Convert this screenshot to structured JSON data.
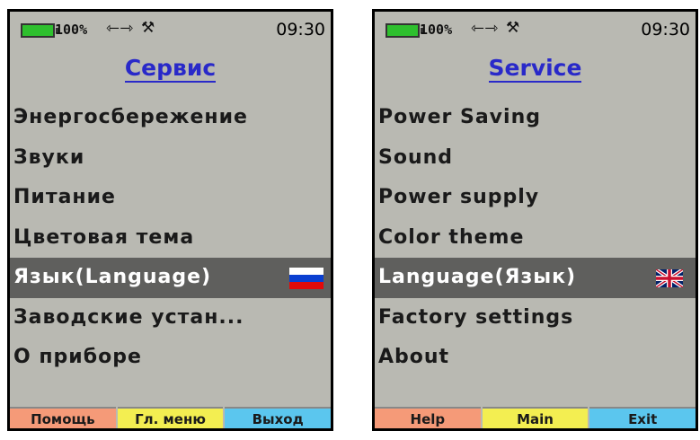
{
  "status": {
    "battery_percent": "100%",
    "usb_icon": "usb-icon",
    "tool_icon": "tool-icon",
    "time": "09:30"
  },
  "screens": [
    {
      "language": "ru",
      "title": "Сервис",
      "items": [
        {
          "label": "Энергосбережение"
        },
        {
          "label": "Звуки"
        },
        {
          "label": "Питание"
        },
        {
          "label": "Цветовая тема"
        },
        {
          "label": "Язык(Language)",
          "selected": true,
          "flag": "russia-flag-icon"
        },
        {
          "label": "Заводские устан..."
        },
        {
          "label": "О приборе"
        }
      ],
      "softkeys": {
        "help": "Помощь",
        "main": "Гл. меню",
        "exit": "Выход"
      }
    },
    {
      "language": "en",
      "title": "Service",
      "items": [
        {
          "label": "Power Saving"
        },
        {
          "label": "Sound"
        },
        {
          "label": "Power supply"
        },
        {
          "label": "Color theme"
        },
        {
          "label": "Language(Язык)",
          "selected": true,
          "flag": "uk-flag-icon"
        },
        {
          "label": "Factory settings"
        },
        {
          "label": "About"
        }
      ],
      "softkeys": {
        "help": "Help",
        "main": "Main",
        "exit": "Exit"
      }
    }
  ],
  "colors": {
    "screen_bg": "#b9b9b2",
    "title": "#2929c9",
    "selected_bg": "#5f5f5d",
    "battery": "#2ec02e",
    "softkey_help": "#f59a78",
    "softkey_main": "#f3ee51",
    "softkey_exit": "#5bc6ee"
  }
}
